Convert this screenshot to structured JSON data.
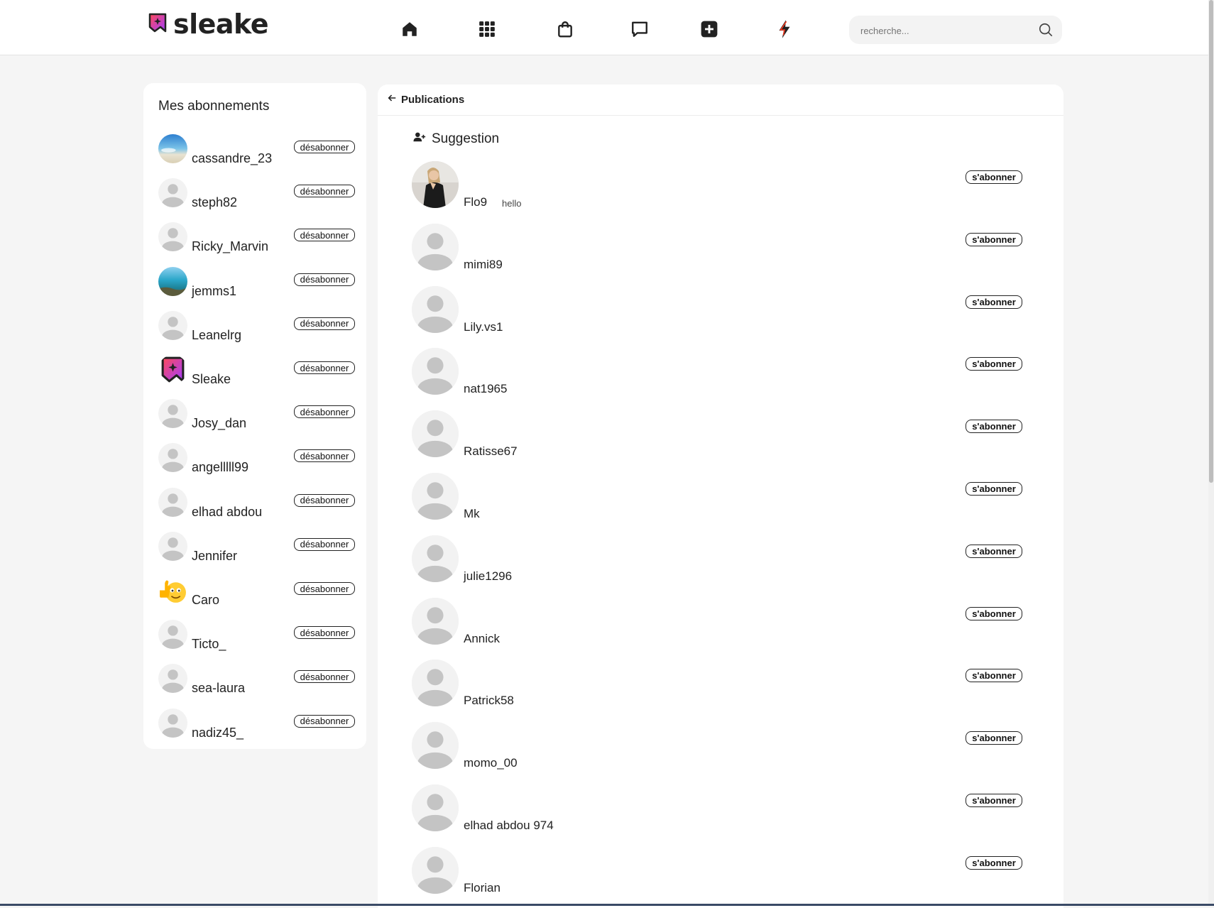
{
  "app": {
    "name": "sleake"
  },
  "header": {
    "nav_icons": [
      "home-icon",
      "grid-icon",
      "shopping-bag-icon",
      "message-icon",
      "add-post-icon",
      "flash-icon"
    ],
    "search": {
      "placeholder": "recherche...",
      "value": ""
    }
  },
  "sidebar": {
    "title": "Mes abonnements",
    "unsubscribe_label": "désabonner",
    "items": [
      {
        "name": "cassandre_23",
        "avatar": "beach-photo"
      },
      {
        "name": "steph82",
        "avatar": "default"
      },
      {
        "name": "Ricky_Marvin",
        "avatar": "default"
      },
      {
        "name": "jemms1",
        "avatar": "sea-photo"
      },
      {
        "name": "Leanelrg",
        "avatar": "default"
      },
      {
        "name": "Sleake",
        "avatar": "sleake-logo"
      },
      {
        "name": "Josy_dan",
        "avatar": "default"
      },
      {
        "name": "angelllll99",
        "avatar": "default"
      },
      {
        "name": "elhad abdou",
        "avatar": "default"
      },
      {
        "name": "Jennifer",
        "avatar": "default"
      },
      {
        "name": "Caro",
        "avatar": "thumbs-up-emoji"
      },
      {
        "name": "Ticto_",
        "avatar": "default"
      },
      {
        "name": "sea-laura",
        "avatar": "default"
      },
      {
        "name": "nadiz45_",
        "avatar": "default"
      }
    ]
  },
  "main": {
    "back_label": "Publications",
    "suggestion_title": "Suggestion",
    "subscribe_label": "s'abonner",
    "suggestions": [
      {
        "name": "Flo9",
        "bio": "hello",
        "avatar": "portrait-photo"
      },
      {
        "name": "mimi89",
        "bio": "",
        "avatar": "default"
      },
      {
        "name": "Lily.vs1",
        "bio": "",
        "avatar": "default"
      },
      {
        "name": "nat1965",
        "bio": "",
        "avatar": "default"
      },
      {
        "name": "Ratisse67",
        "bio": "",
        "avatar": "default"
      },
      {
        "name": "Mk",
        "bio": "",
        "avatar": "default"
      },
      {
        "name": "julie1296",
        "bio": "",
        "avatar": "default"
      },
      {
        "name": "Annick",
        "bio": "",
        "avatar": "default"
      },
      {
        "name": "Patrick58",
        "bio": "",
        "avatar": "default"
      },
      {
        "name": "momo_00",
        "bio": "",
        "avatar": "default"
      },
      {
        "name": "elhad abdou 974",
        "bio": "",
        "avatar": "default"
      },
      {
        "name": "Florian",
        "bio": "",
        "avatar": "default"
      }
    ]
  },
  "colors": {
    "brand_gradient": [
      "#ff3c6e",
      "#a03cff"
    ],
    "flash": "#ff3b1f",
    "default_avatar": "#c4c4c4"
  }
}
